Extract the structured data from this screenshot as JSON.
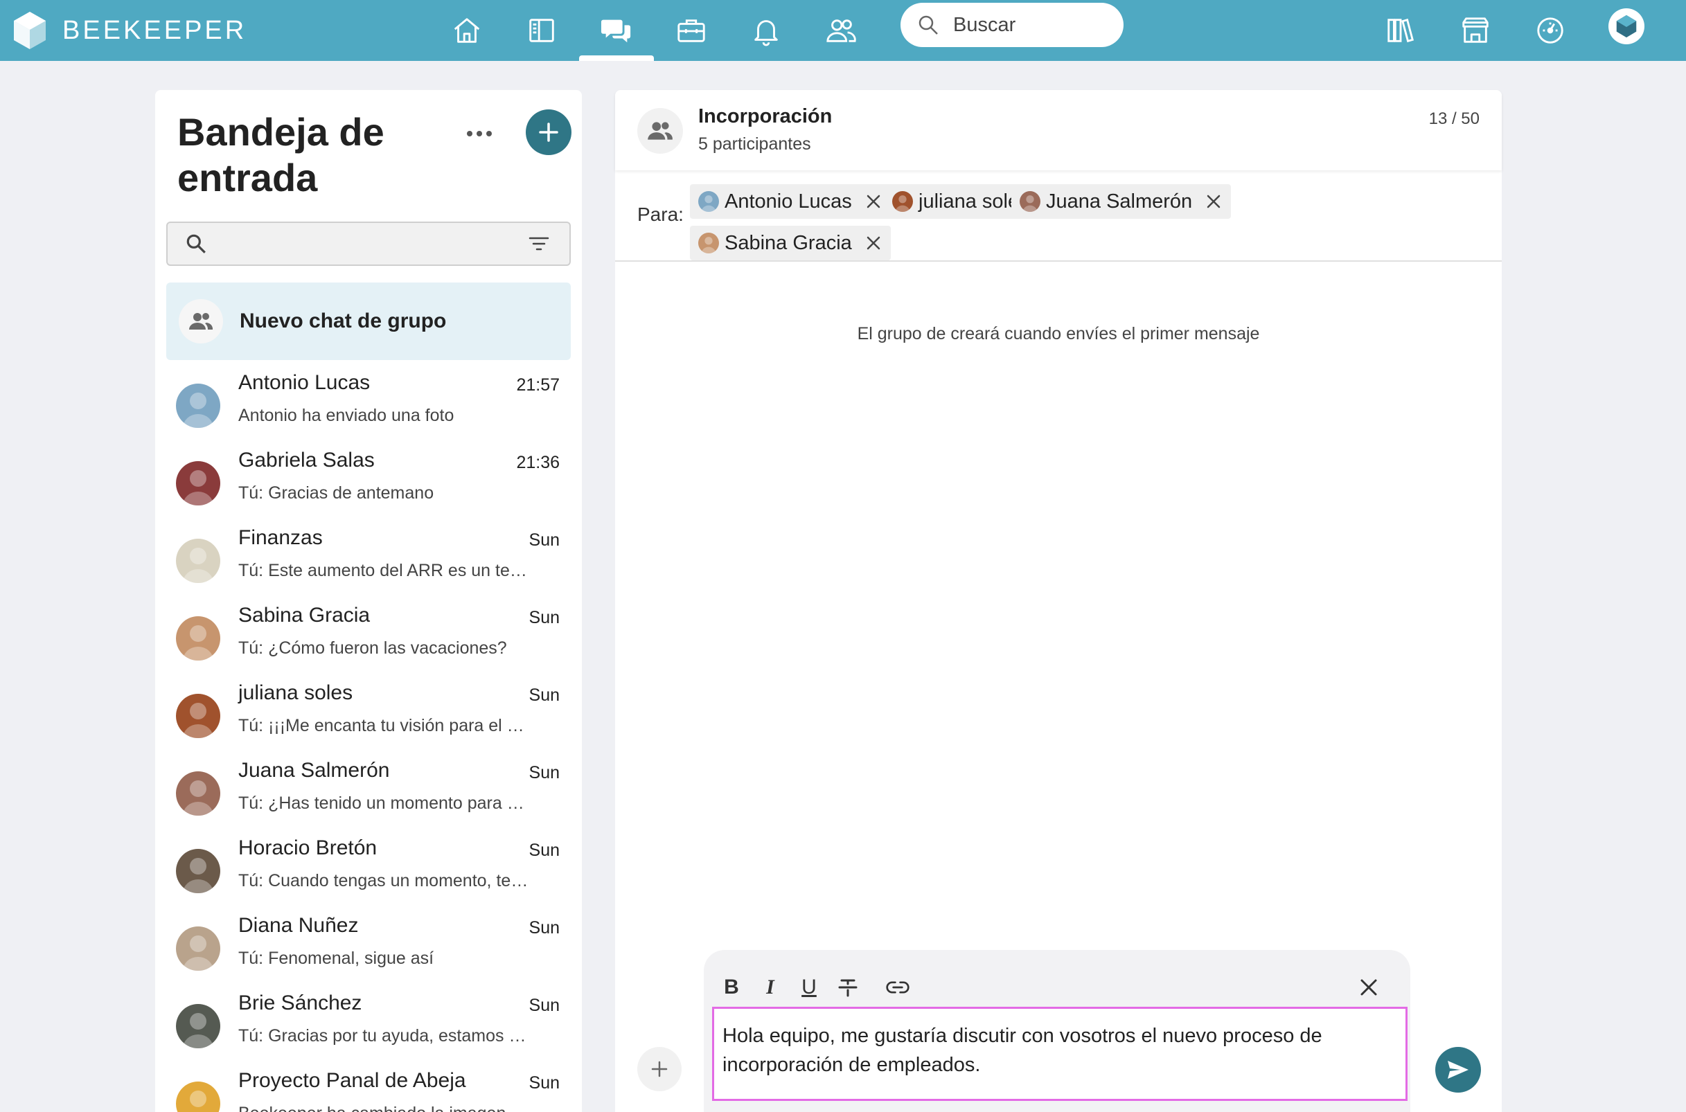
{
  "app": {
    "name": "BEEKEEPER"
  },
  "topnav": {
    "items": [
      {
        "name": "home-icon"
      },
      {
        "name": "stream-icon"
      },
      {
        "name": "chats-icon"
      },
      {
        "name": "tools-icon"
      },
      {
        "name": "notifications-icon"
      },
      {
        "name": "people-icon"
      }
    ],
    "active": "chats-icon",
    "search_placeholder": "Buscar",
    "right_items": [
      {
        "name": "library-icon"
      },
      {
        "name": "store-icon"
      },
      {
        "name": "dashboard-icon"
      }
    ]
  },
  "inbox": {
    "title": "Bandeja de entrada",
    "new_group_label": "Nuevo chat de grupo",
    "chats": [
      {
        "name": "Antonio Lucas",
        "time": "21:57",
        "preview": "Antonio ha enviado una foto",
        "avatar": "#7ea7c4"
      },
      {
        "name": "Gabriela Salas",
        "time": "21:36",
        "preview": "Tú: Gracias de antemano",
        "avatar": "#8a3b3b"
      },
      {
        "name": "Finanzas",
        "time": "Sun",
        "preview": "Tú: Este aumento del ARR es un testimonio",
        "avatar": "#d9d3c1"
      },
      {
        "name": "Sabina Gracia",
        "time": "Sun",
        "preview": "Tú: ¿Cómo fueron las vacaciones?",
        "avatar": "#c7956e"
      },
      {
        "name": "juliana soles",
        "time": "Sun",
        "preview": "Tú: ¡¡¡Me encanta tu visión para el proyecto!!!",
        "avatar": "#a0522d"
      },
      {
        "name": "Juana Salmerón",
        "time": "Sun",
        "preview": "Tú: ¿Has tenido un momento para revisar",
        "avatar": "#9b6b5a"
      },
      {
        "name": "Horacio Bretón",
        "time": "Sun",
        "preview": "Tú: Cuando tengas un momento, te agradecería",
        "avatar": "#6b5a4a"
      },
      {
        "name": "Diana Nuñez",
        "time": "Sun",
        "preview": "Tú: Fenomenal, sigue así",
        "avatar": "#b9a38c"
      },
      {
        "name": "Brie Sánchez",
        "time": "Sun",
        "preview": "Tú: Gracias por tu ayuda, estamos en contacto",
        "avatar": "#555a52"
      },
      {
        "name": "Proyecto Panal de Abeja",
        "time": "Sun",
        "preview": "Beekeeper ha cambiado la imagen",
        "avatar": "#e2a93a"
      }
    ]
  },
  "conversation": {
    "title": "Incorporación",
    "subtitle": "5 participantes",
    "char_count": "13 / 50",
    "to_label": "Para:",
    "recipients": [
      {
        "name": "Antonio Lucas",
        "avatar": "#7ea7c4"
      },
      {
        "name": "juliana soles",
        "avatar": "#a0522d"
      },
      {
        "name": "Juana Salmerón",
        "avatar": "#9b6b5a"
      },
      {
        "name": "Sabina Gracia",
        "avatar": "#c7956e"
      }
    ],
    "info": "El grupo de creará cuando envíes el primer mensaje",
    "composer": {
      "bold": "B",
      "italic": "I",
      "underline": "U",
      "text": "Hola equipo, me gustaría discutir con vosotros el nuevo proceso de incorporación de empleados."
    }
  },
  "colors": {
    "topbar": "#4fa9c2",
    "accent": "#2f7686",
    "selected_row": "#e4f1f6",
    "editor_border": "#e36be5"
  }
}
